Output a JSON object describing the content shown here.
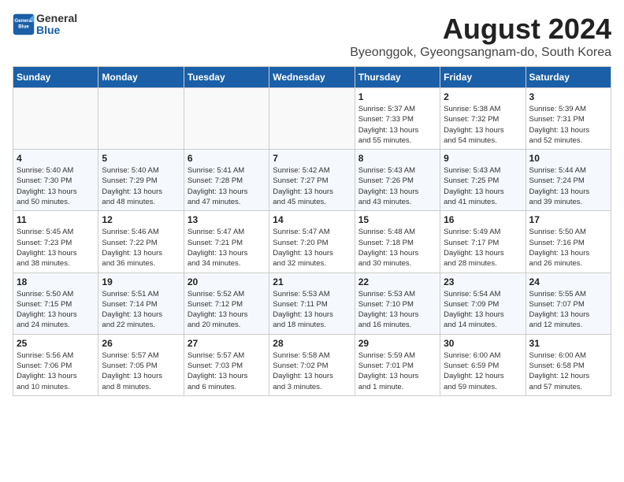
{
  "header": {
    "logo_general": "General",
    "logo_blue": "Blue",
    "month": "August 2024",
    "location": "Byeonggok, Gyeongsangnam-do, South Korea"
  },
  "days_of_week": [
    "Sunday",
    "Monday",
    "Tuesday",
    "Wednesday",
    "Thursday",
    "Friday",
    "Saturday"
  ],
  "weeks": [
    [
      {
        "day": "",
        "info": ""
      },
      {
        "day": "",
        "info": ""
      },
      {
        "day": "",
        "info": ""
      },
      {
        "day": "",
        "info": ""
      },
      {
        "day": "1",
        "info": "Sunrise: 5:37 AM\nSunset: 7:33 PM\nDaylight: 13 hours\nand 55 minutes."
      },
      {
        "day": "2",
        "info": "Sunrise: 5:38 AM\nSunset: 7:32 PM\nDaylight: 13 hours\nand 54 minutes."
      },
      {
        "day": "3",
        "info": "Sunrise: 5:39 AM\nSunset: 7:31 PM\nDaylight: 13 hours\nand 52 minutes."
      }
    ],
    [
      {
        "day": "4",
        "info": "Sunrise: 5:40 AM\nSunset: 7:30 PM\nDaylight: 13 hours\nand 50 minutes."
      },
      {
        "day": "5",
        "info": "Sunrise: 5:40 AM\nSunset: 7:29 PM\nDaylight: 13 hours\nand 48 minutes."
      },
      {
        "day": "6",
        "info": "Sunrise: 5:41 AM\nSunset: 7:28 PM\nDaylight: 13 hours\nand 47 minutes."
      },
      {
        "day": "7",
        "info": "Sunrise: 5:42 AM\nSunset: 7:27 PM\nDaylight: 13 hours\nand 45 minutes."
      },
      {
        "day": "8",
        "info": "Sunrise: 5:43 AM\nSunset: 7:26 PM\nDaylight: 13 hours\nand 43 minutes."
      },
      {
        "day": "9",
        "info": "Sunrise: 5:43 AM\nSunset: 7:25 PM\nDaylight: 13 hours\nand 41 minutes."
      },
      {
        "day": "10",
        "info": "Sunrise: 5:44 AM\nSunset: 7:24 PM\nDaylight: 13 hours\nand 39 minutes."
      }
    ],
    [
      {
        "day": "11",
        "info": "Sunrise: 5:45 AM\nSunset: 7:23 PM\nDaylight: 13 hours\nand 38 minutes."
      },
      {
        "day": "12",
        "info": "Sunrise: 5:46 AM\nSunset: 7:22 PM\nDaylight: 13 hours\nand 36 minutes."
      },
      {
        "day": "13",
        "info": "Sunrise: 5:47 AM\nSunset: 7:21 PM\nDaylight: 13 hours\nand 34 minutes."
      },
      {
        "day": "14",
        "info": "Sunrise: 5:47 AM\nSunset: 7:20 PM\nDaylight: 13 hours\nand 32 minutes."
      },
      {
        "day": "15",
        "info": "Sunrise: 5:48 AM\nSunset: 7:18 PM\nDaylight: 13 hours\nand 30 minutes."
      },
      {
        "day": "16",
        "info": "Sunrise: 5:49 AM\nSunset: 7:17 PM\nDaylight: 13 hours\nand 28 minutes."
      },
      {
        "day": "17",
        "info": "Sunrise: 5:50 AM\nSunset: 7:16 PM\nDaylight: 13 hours\nand 26 minutes."
      }
    ],
    [
      {
        "day": "18",
        "info": "Sunrise: 5:50 AM\nSunset: 7:15 PM\nDaylight: 13 hours\nand 24 minutes."
      },
      {
        "day": "19",
        "info": "Sunrise: 5:51 AM\nSunset: 7:14 PM\nDaylight: 13 hours\nand 22 minutes."
      },
      {
        "day": "20",
        "info": "Sunrise: 5:52 AM\nSunset: 7:12 PM\nDaylight: 13 hours\nand 20 minutes."
      },
      {
        "day": "21",
        "info": "Sunrise: 5:53 AM\nSunset: 7:11 PM\nDaylight: 13 hours\nand 18 minutes."
      },
      {
        "day": "22",
        "info": "Sunrise: 5:53 AM\nSunset: 7:10 PM\nDaylight: 13 hours\nand 16 minutes."
      },
      {
        "day": "23",
        "info": "Sunrise: 5:54 AM\nSunset: 7:09 PM\nDaylight: 13 hours\nand 14 minutes."
      },
      {
        "day": "24",
        "info": "Sunrise: 5:55 AM\nSunset: 7:07 PM\nDaylight: 13 hours\nand 12 minutes."
      }
    ],
    [
      {
        "day": "25",
        "info": "Sunrise: 5:56 AM\nSunset: 7:06 PM\nDaylight: 13 hours\nand 10 minutes."
      },
      {
        "day": "26",
        "info": "Sunrise: 5:57 AM\nSunset: 7:05 PM\nDaylight: 13 hours\nand 8 minutes."
      },
      {
        "day": "27",
        "info": "Sunrise: 5:57 AM\nSunset: 7:03 PM\nDaylight: 13 hours\nand 6 minutes."
      },
      {
        "day": "28",
        "info": "Sunrise: 5:58 AM\nSunset: 7:02 PM\nDaylight: 13 hours\nand 3 minutes."
      },
      {
        "day": "29",
        "info": "Sunrise: 5:59 AM\nSunset: 7:01 PM\nDaylight: 13 hours\nand 1 minute."
      },
      {
        "day": "30",
        "info": "Sunrise: 6:00 AM\nSunset: 6:59 PM\nDaylight: 12 hours\nand 59 minutes."
      },
      {
        "day": "31",
        "info": "Sunrise: 6:00 AM\nSunset: 6:58 PM\nDaylight: 12 hours\nand 57 minutes."
      }
    ]
  ]
}
